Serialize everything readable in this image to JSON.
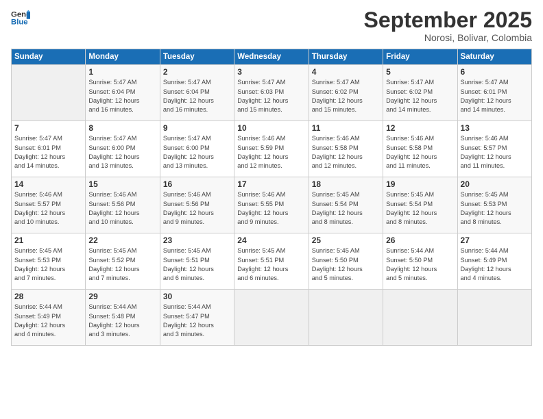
{
  "header": {
    "logo_general": "General",
    "logo_blue": "Blue",
    "month": "September 2025",
    "location": "Norosi, Bolivar, Colombia"
  },
  "columns": [
    "Sunday",
    "Monday",
    "Tuesday",
    "Wednesday",
    "Thursday",
    "Friday",
    "Saturday"
  ],
  "weeks": [
    [
      {
        "day": "",
        "info": ""
      },
      {
        "day": "1",
        "info": "Sunrise: 5:47 AM\nSunset: 6:04 PM\nDaylight: 12 hours\nand 16 minutes."
      },
      {
        "day": "2",
        "info": "Sunrise: 5:47 AM\nSunset: 6:04 PM\nDaylight: 12 hours\nand 16 minutes."
      },
      {
        "day": "3",
        "info": "Sunrise: 5:47 AM\nSunset: 6:03 PM\nDaylight: 12 hours\nand 15 minutes."
      },
      {
        "day": "4",
        "info": "Sunrise: 5:47 AM\nSunset: 6:02 PM\nDaylight: 12 hours\nand 15 minutes."
      },
      {
        "day": "5",
        "info": "Sunrise: 5:47 AM\nSunset: 6:02 PM\nDaylight: 12 hours\nand 14 minutes."
      },
      {
        "day": "6",
        "info": "Sunrise: 5:47 AM\nSunset: 6:01 PM\nDaylight: 12 hours\nand 14 minutes."
      }
    ],
    [
      {
        "day": "7",
        "info": "Sunrise: 5:47 AM\nSunset: 6:01 PM\nDaylight: 12 hours\nand 14 minutes."
      },
      {
        "day": "8",
        "info": "Sunrise: 5:47 AM\nSunset: 6:00 PM\nDaylight: 12 hours\nand 13 minutes."
      },
      {
        "day": "9",
        "info": "Sunrise: 5:47 AM\nSunset: 6:00 PM\nDaylight: 12 hours\nand 13 minutes."
      },
      {
        "day": "10",
        "info": "Sunrise: 5:46 AM\nSunset: 5:59 PM\nDaylight: 12 hours\nand 12 minutes."
      },
      {
        "day": "11",
        "info": "Sunrise: 5:46 AM\nSunset: 5:58 PM\nDaylight: 12 hours\nand 12 minutes."
      },
      {
        "day": "12",
        "info": "Sunrise: 5:46 AM\nSunset: 5:58 PM\nDaylight: 12 hours\nand 11 minutes."
      },
      {
        "day": "13",
        "info": "Sunrise: 5:46 AM\nSunset: 5:57 PM\nDaylight: 12 hours\nand 11 minutes."
      }
    ],
    [
      {
        "day": "14",
        "info": "Sunrise: 5:46 AM\nSunset: 5:57 PM\nDaylight: 12 hours\nand 10 minutes."
      },
      {
        "day": "15",
        "info": "Sunrise: 5:46 AM\nSunset: 5:56 PM\nDaylight: 12 hours\nand 10 minutes."
      },
      {
        "day": "16",
        "info": "Sunrise: 5:46 AM\nSunset: 5:56 PM\nDaylight: 12 hours\nand 9 minutes."
      },
      {
        "day": "17",
        "info": "Sunrise: 5:46 AM\nSunset: 5:55 PM\nDaylight: 12 hours\nand 9 minutes."
      },
      {
        "day": "18",
        "info": "Sunrise: 5:45 AM\nSunset: 5:54 PM\nDaylight: 12 hours\nand 8 minutes."
      },
      {
        "day": "19",
        "info": "Sunrise: 5:45 AM\nSunset: 5:54 PM\nDaylight: 12 hours\nand 8 minutes."
      },
      {
        "day": "20",
        "info": "Sunrise: 5:45 AM\nSunset: 5:53 PM\nDaylight: 12 hours\nand 8 minutes."
      }
    ],
    [
      {
        "day": "21",
        "info": "Sunrise: 5:45 AM\nSunset: 5:53 PM\nDaylight: 12 hours\nand 7 minutes."
      },
      {
        "day": "22",
        "info": "Sunrise: 5:45 AM\nSunset: 5:52 PM\nDaylight: 12 hours\nand 7 minutes."
      },
      {
        "day": "23",
        "info": "Sunrise: 5:45 AM\nSunset: 5:51 PM\nDaylight: 12 hours\nand 6 minutes."
      },
      {
        "day": "24",
        "info": "Sunrise: 5:45 AM\nSunset: 5:51 PM\nDaylight: 12 hours\nand 6 minutes."
      },
      {
        "day": "25",
        "info": "Sunrise: 5:45 AM\nSunset: 5:50 PM\nDaylight: 12 hours\nand 5 minutes."
      },
      {
        "day": "26",
        "info": "Sunrise: 5:44 AM\nSunset: 5:50 PM\nDaylight: 12 hours\nand 5 minutes."
      },
      {
        "day": "27",
        "info": "Sunrise: 5:44 AM\nSunset: 5:49 PM\nDaylight: 12 hours\nand 4 minutes."
      }
    ],
    [
      {
        "day": "28",
        "info": "Sunrise: 5:44 AM\nSunset: 5:49 PM\nDaylight: 12 hours\nand 4 minutes."
      },
      {
        "day": "29",
        "info": "Sunrise: 5:44 AM\nSunset: 5:48 PM\nDaylight: 12 hours\nand 3 minutes."
      },
      {
        "day": "30",
        "info": "Sunrise: 5:44 AM\nSunset: 5:47 PM\nDaylight: 12 hours\nand 3 minutes."
      },
      {
        "day": "",
        "info": ""
      },
      {
        "day": "",
        "info": ""
      },
      {
        "day": "",
        "info": ""
      },
      {
        "day": "",
        "info": ""
      }
    ]
  ]
}
